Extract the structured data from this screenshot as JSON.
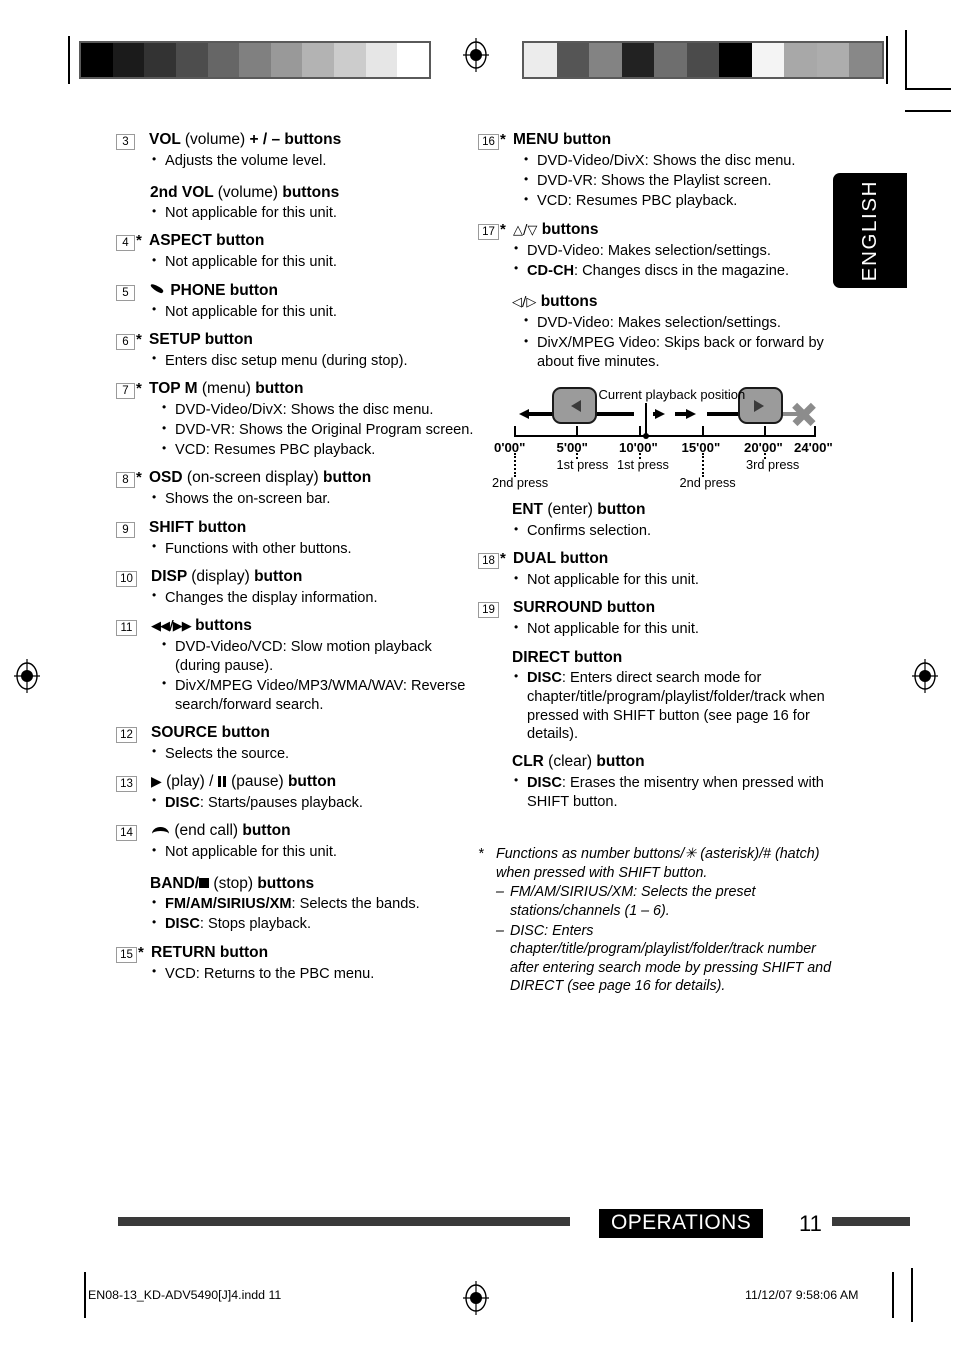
{
  "language_tab": "ENGLISH",
  "left_column": [
    {
      "number": "3",
      "asterisk": false,
      "title_parts": [
        {
          "t": "VOL ",
          "b": true
        },
        {
          "t": "(volume) ",
          "b": false
        },
        {
          "t": "+ / – buttons",
          "b": true
        }
      ],
      "bullets": [
        "Adjusts the volume level."
      ],
      "subsection": {
        "title_parts": [
          {
            "t": "2nd VOL ",
            "b": true
          },
          {
            "t": "(volume) ",
            "b": false
          },
          {
            "t": "buttons",
            "b": true
          }
        ],
        "bullets": [
          "Not applicable for this unit."
        ]
      }
    },
    {
      "number": "4",
      "asterisk": true,
      "title_parts": [
        {
          "t": "ASPECT button",
          "b": true
        }
      ],
      "bullets": [
        "Not applicable for this unit."
      ]
    },
    {
      "number": "5",
      "asterisk": false,
      "icon": "phone-icon",
      "title_parts": [
        {
          "t": "PHONE button",
          "b": true
        }
      ],
      "bullets": [
        "Not applicable for this unit."
      ]
    },
    {
      "number": "6",
      "asterisk": true,
      "title_parts": [
        {
          "t": "SETUP button",
          "b": true
        }
      ],
      "bullets": [
        "Enters disc setup menu (during stop)."
      ]
    },
    {
      "number": "7",
      "asterisk": true,
      "title_parts": [
        {
          "t": "TOP M ",
          "b": true
        },
        {
          "t": "(menu) ",
          "b": false
        },
        {
          "t": "button",
          "b": true
        }
      ],
      "bullets": [
        "DVD-Video/DivX: Shows the disc menu.",
        "DVD-VR: Shows the Original Program screen.",
        "VCD: Resumes PBC playback."
      ]
    },
    {
      "number": "8",
      "asterisk": true,
      "title_parts": [
        {
          "t": "OSD ",
          "b": true
        },
        {
          "t": "(on-screen display) ",
          "b": false
        },
        {
          "t": "button",
          "b": true
        }
      ],
      "bullets": [
        "Shows the on-screen bar."
      ]
    },
    {
      "number": "9",
      "asterisk": false,
      "title_parts": [
        {
          "t": "SHIFT button",
          "b": true
        }
      ],
      "bullets": [
        "Functions with other buttons."
      ]
    },
    {
      "number": "10",
      "asterisk": false,
      "title_parts": [
        {
          "t": "DISP ",
          "b": true
        },
        {
          "t": "(display) ",
          "b": false
        },
        {
          "t": "button",
          "b": true
        }
      ],
      "bullets": [
        "Changes the display information."
      ]
    },
    {
      "number": "11",
      "asterisk": false,
      "icon": "rewind-forward-icon",
      "title_parts": [
        {
          "t": "buttons",
          "b": true
        }
      ],
      "bullets": [
        "DVD-Video/VCD: Slow motion playback (during pause).",
        "DivX/MPEG Video/MP3/WMA/WAV: Reverse search/forward search."
      ]
    },
    {
      "number": "12",
      "asterisk": false,
      "title_parts": [
        {
          "t": "SOURCE button",
          "b": true
        }
      ],
      "bullets": [
        "Selects the source."
      ]
    },
    {
      "number": "13",
      "asterisk": false,
      "icon": "play-pause-icon",
      "title_parts": [
        {
          "t": "button",
          "b": true
        }
      ],
      "bullets_rich": [
        {
          "bold": "DISC",
          "rest": ": Starts/pauses playback."
        }
      ]
    },
    {
      "number": "14",
      "asterisk": false,
      "icon": "end-call-icon",
      "title_parts": [
        {
          "t": "(end call) ",
          "b": false
        },
        {
          "t": "button",
          "b": true
        }
      ],
      "bullets": [
        "Not applicable for this unit."
      ],
      "subsection": {
        "icon": "band-stop-icon",
        "title_parts": [
          {
            "t": "BAND/",
            "b": true
          },
          {
            "t": "(stop) ",
            "b": false
          },
          {
            "t": "buttons",
            "b": true
          }
        ],
        "bullets_rich": [
          {
            "bold": "FM/AM/SIRIUS/XM",
            "rest": ": Selects the bands."
          },
          {
            "bold": "DISC",
            "rest": ": Stops playback."
          }
        ]
      }
    },
    {
      "number": "15",
      "asterisk": true,
      "title_parts": [
        {
          "t": "RETURN button",
          "b": true
        }
      ],
      "bullets": [
        "VCD: Returns to the PBC menu."
      ]
    }
  ],
  "right_column": [
    {
      "number": "16",
      "asterisk": true,
      "title_parts": [
        {
          "t": "MENU button",
          "b": true
        }
      ],
      "bullets": [
        "DVD-Video/DivX: Shows the disc menu.",
        "DVD-VR: Shows the Playlist screen.",
        "VCD: Resumes PBC playback."
      ]
    },
    {
      "number": "17",
      "asterisk": true,
      "icon": "up-down-triangle-icon",
      "title_parts": [
        {
          "t": "buttons",
          "b": true
        }
      ],
      "bullets_rich": [
        {
          "bold": "",
          "rest": "DVD-Video: Makes selection/settings."
        },
        {
          "bold": "CD-CH",
          "rest": ": Changes discs in the magazine."
        }
      ],
      "subsection": {
        "icon": "left-right-triangle-icon",
        "title_parts": [
          {
            "t": "buttons",
            "b": true
          }
        ],
        "bullets": [
          "DVD-Video: Makes selection/settings.",
          "DivX/MPEG Video: Skips back or forward by about five minutes."
        ]
      }
    }
  ],
  "right_column_after_diagram": [
    {
      "number": "",
      "asterisk": false,
      "title_parts": [
        {
          "t": "ENT ",
          "b": true
        },
        {
          "t": "(enter) ",
          "b": false
        },
        {
          "t": "button",
          "b": true
        }
      ],
      "bullets": [
        "Confirms selection."
      ]
    },
    {
      "number": "18",
      "asterisk": true,
      "title_parts": [
        {
          "t": "DUAL button",
          "b": true
        }
      ],
      "bullets": [
        "Not applicable for this unit."
      ]
    },
    {
      "number": "19",
      "asterisk": false,
      "title_parts": [
        {
          "t": "SURROUND button",
          "b": true
        }
      ],
      "bullets": [
        "Not applicable for this unit."
      ]
    },
    {
      "number": "",
      "asterisk": false,
      "title_parts": [
        {
          "t": "DIRECT button",
          "b": true
        }
      ],
      "bullets_rich": [
        {
          "bold": "DISC",
          "rest": ": Enters direct search mode for chapter/title/program/playlist/folder/track when pressed with SHIFT button (see page 16 for details)."
        }
      ]
    },
    {
      "number": "",
      "asterisk": false,
      "title_parts": [
        {
          "t": "CLR ",
          "b": true
        },
        {
          "t": "(clear) ",
          "b": false
        },
        {
          "t": "button",
          "b": true
        }
      ],
      "bullets_rich": [
        {
          "bold": "DISC",
          "rest": ": Erases the misentry when pressed with SHIFT button."
        }
      ]
    }
  ],
  "diagram": {
    "current_position_label": "Current playback position",
    "tick_labels": [
      "0'00\"",
      "5'00\"",
      "10'00\"",
      "15'00\"",
      "20'00\"",
      "24'00\""
    ],
    "press_labels": [
      {
        "text": "2nd press",
        "tick": "0'00\""
      },
      {
        "text": "1st press",
        "tick": "5'00\""
      },
      {
        "text": "1st press",
        "tick": "10'00\""
      },
      {
        "text": "2nd press",
        "tick": "15'00\""
      },
      {
        "text": "3rd press",
        "tick": "20'00\""
      }
    ],
    "left_key_icon": "left-triangle-key-icon",
    "right_key_icon": "right-triangle-key-icon",
    "blocked_icon": "x-cross-icon"
  },
  "footnote": {
    "mark": "*",
    "main": "Functions as number buttons/✳ (asterisk)/# (hatch) when pressed with SHIFT button.",
    "items": [
      {
        "mark": "–",
        "text": "FM/AM/SIRIUS/XM: Selects the preset stations/channels (1 – 6)."
      },
      {
        "mark": "–",
        "text": "DISC: Enters chapter/title/program/playlist/folder/track number after entering search mode by pressing SHIFT and DIRECT (see page 16 for details)."
      }
    ]
  },
  "footer": {
    "section_label": "OPERATIONS",
    "page_number": "11",
    "print_file": "EN08-13_KD-ADV5490[J]4.indd   11",
    "print_timestamp": "11/12/07   9:58:06 AM"
  },
  "colors": {
    "ink": "#000000",
    "paper": "#ffffff",
    "rule": "#3a3a3a",
    "numbox_border": "#9a9a9a",
    "key_fill": "#9b9b9b",
    "blocked_gray": "#8c8c8c"
  },
  "grayscale_bar_left": [
    "#000000",
    "#1b1b1b",
    "#333333",
    "#4d4d4d",
    "#666666",
    "#808080",
    "#999999",
    "#b3b3b3",
    "#cccccc",
    "#e6e6e6",
    "#ffffff"
  ],
  "grayscale_bar_right": [
    "#ececec",
    "#555555",
    "#838383",
    "#222222",
    "#6e6e6e",
    "#4b4b4b",
    "#000000",
    "#f4f4f4",
    "#a8a8a8",
    "#adadad",
    "#888888"
  ]
}
